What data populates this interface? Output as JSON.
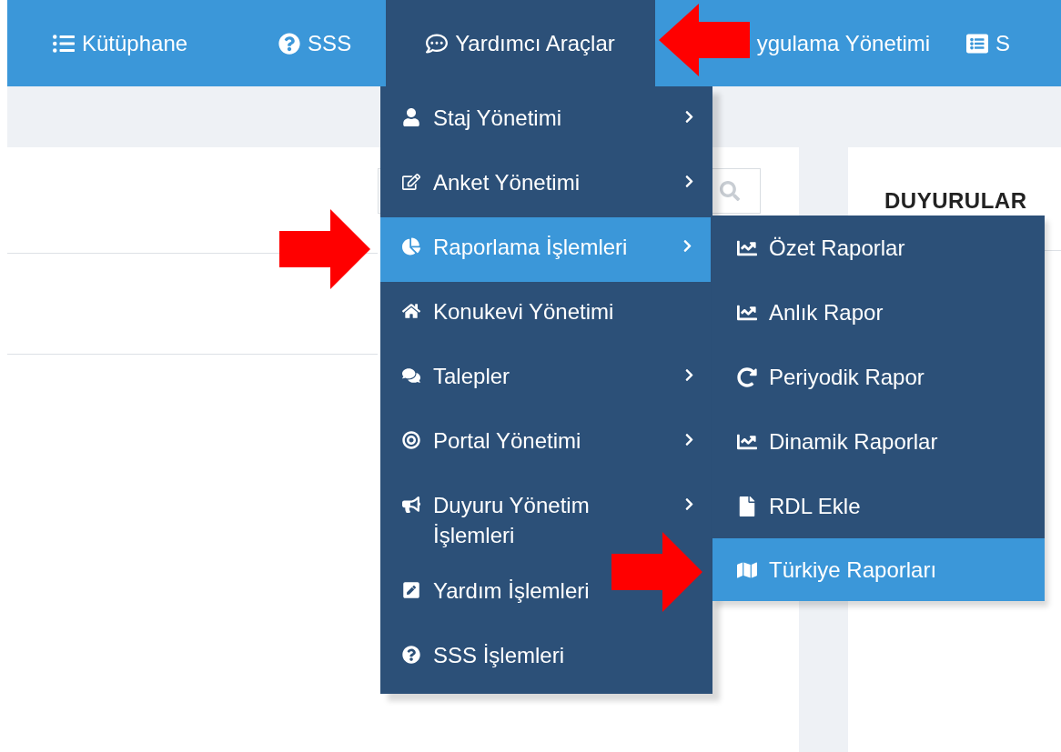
{
  "navbar": {
    "items": [
      {
        "label": "Kütüphane",
        "selected": false
      },
      {
        "label": "SSS",
        "selected": false
      },
      {
        "label": "Yardımcı Araçlar",
        "selected": true
      },
      {
        "label": "ygulama Yönetimi",
        "selected": false
      },
      {
        "label": "S",
        "selected": false
      }
    ]
  },
  "announcements": {
    "title": "DUYURULAR"
  },
  "menu": {
    "items": [
      {
        "label": "Staj Yönetimi",
        "selected": false,
        "submenu": true
      },
      {
        "label": "Anket Yönetimi",
        "selected": false,
        "submenu": true
      },
      {
        "label": "Raporlama İşlemleri",
        "selected": true,
        "submenu": true
      },
      {
        "label": "Konukevi Yönetimi",
        "selected": false,
        "submenu": false
      },
      {
        "label": "Talepler",
        "selected": false,
        "submenu": true
      },
      {
        "label": "Portal Yönetimi",
        "selected": false,
        "submenu": true
      },
      {
        "label": "Duyuru Yönetim İşlemleri",
        "selected": false,
        "submenu": true
      },
      {
        "label": "Yardım İşlemleri",
        "selected": false,
        "submenu": false
      },
      {
        "label": "SSS İşlemleri",
        "selected": false,
        "submenu": false
      }
    ]
  },
  "submenu": {
    "items": [
      {
        "label": "Özet Raporlar",
        "selected": false
      },
      {
        "label": "Anlık Rapor",
        "selected": false
      },
      {
        "label": "Periyodik Rapor",
        "selected": false
      },
      {
        "label": "Dinamik Raporlar",
        "selected": false
      },
      {
        "label": "RDL Ekle",
        "selected": false
      },
      {
        "label": "Türkiye Raporları",
        "selected": true
      }
    ]
  }
}
